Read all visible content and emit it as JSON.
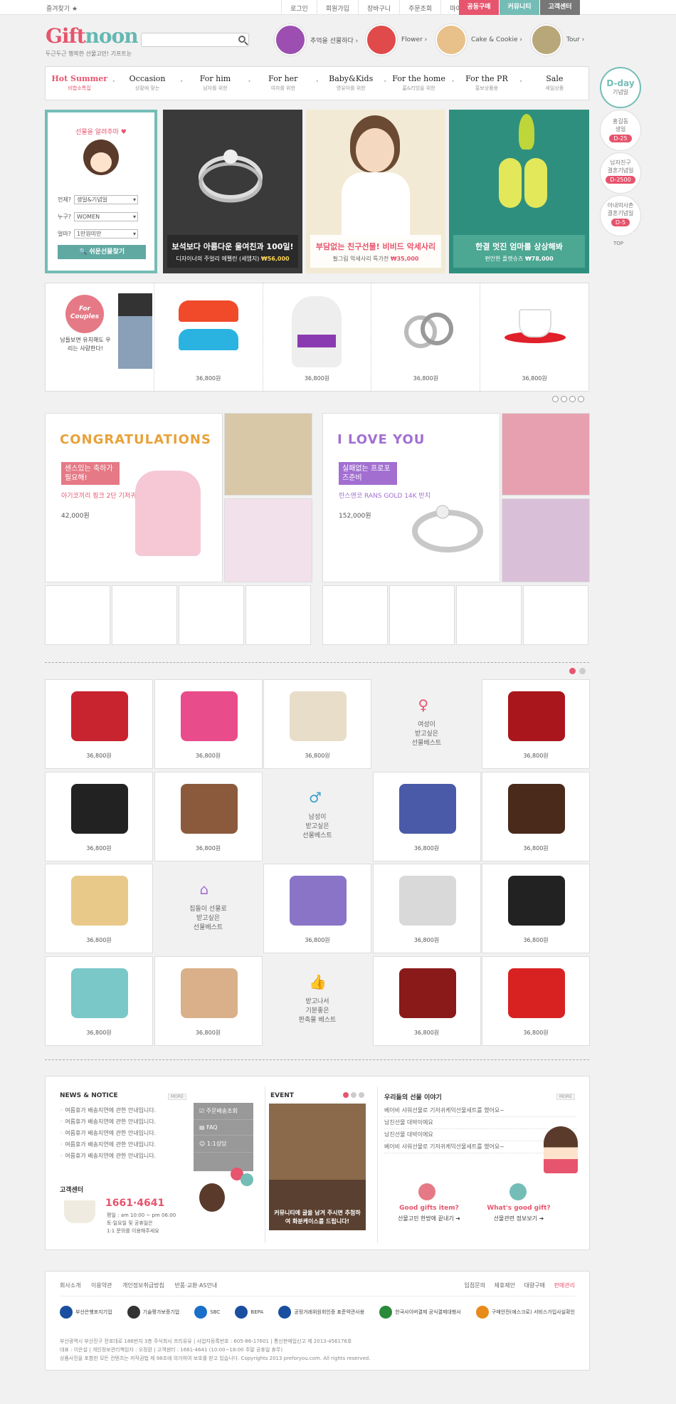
{
  "topbar": {
    "favorite": "즐겨찾기 ★",
    "links": [
      "로그인",
      "회원가입",
      "장바구니",
      "주문조회",
      "마이페이지"
    ],
    "buttons": [
      {
        "label": "공동구매",
        "color": "#e7546d"
      },
      {
        "label": "커뮤니티",
        "color": "#74bdb6"
      },
      {
        "label": "고객센터",
        "color": "#777777"
      }
    ]
  },
  "logo": {
    "part1": "Gift",
    "part2": "noon",
    "tagline": "두근두근 행복한 선물고민! 기프트눈"
  },
  "quick": [
    {
      "label": "추억을 선물하다 ›",
      "color": "#9c4fb0"
    },
    {
      "label": "Flower ›",
      "color": "#e04a4a"
    },
    {
      "label": "Cake & Cookie ›",
      "color": "#e8c08a"
    },
    {
      "label": "Tour ›",
      "color": "#b8a779"
    }
  ],
  "nav": [
    {
      "en": "Hot Summer",
      "ko": "비합소특집"
    },
    {
      "en": "Occasion",
      "ko": "상황에 맞는"
    },
    {
      "en": "For him",
      "ko": "남자를 위한"
    },
    {
      "en": "For her",
      "ko": "여자를 위한"
    },
    {
      "en": "Baby&Kids",
      "ko": "영유아를 위한"
    },
    {
      "en": "For the home",
      "ko": "홈&리빙을 위한"
    },
    {
      "en": "For the PR",
      "ko": "홍보상품용"
    },
    {
      "en": "Sale",
      "ko": "세일상품"
    }
  ],
  "dday": [
    {
      "title": "D-day",
      "sub": "기념일",
      "pill": ""
    },
    {
      "title": "홍길동",
      "sub": "생일",
      "pill": "D-25"
    },
    {
      "title": "남자친구",
      "sub": "결혼기념일",
      "pill": "D-2500"
    },
    {
      "title": "아내의사촌",
      "sub": "결혼기념일",
      "pill": "D-5"
    }
  ],
  "top_label": "TOP",
  "giftform": {
    "title": "선물을 알려주마 ♥",
    "rows": [
      {
        "label": "언제?",
        "value": "생일&기념일"
      },
      {
        "label": "누구?",
        "value": "WOMEN"
      },
      {
        "label": "얼마?",
        "value": "1만원미만"
      }
    ],
    "button": "🔍 쉬운선물찾기"
  },
  "banners": [
    {
      "title": "보석보다 아름다운 울여친과 100일!",
      "sub": "디자이너의 주얼리 에펠런 (세엠지)",
      "price": "₩56,000",
      "bg": "#3a3a3a",
      "cap": "rgba(40,40,40,.85)"
    },
    {
      "title": "부담없는 친구선물! 비비드 악세사리",
      "sub": "필그림 악세사리 특가전",
      "price": "₩35,000",
      "bg": "#f3ead5",
      "cap": "rgba(255,255,255,.85)"
    },
    {
      "title": "한결 멋진 엄마를 상상해봐",
      "sub": "편안한 플랫슈즈",
      "price": "₩78,000",
      "bg": "#2f8f7e",
      "cap": "rgba(50,150,130,.85)"
    }
  ],
  "strip": {
    "promo": "For Couples",
    "promo_text": "남들보면 유치해도 우리는 사랑한다!",
    "prices": [
      "36,800원",
      "36,800원",
      "36,800원",
      "36,800원",
      "36,800원"
    ]
  },
  "promos": [
    {
      "heading": "CONGRATULATIONS",
      "tag": "센스있는 축하가 필요해!",
      "name": "아기코끼리 핑크 2단 기저귀케익",
      "price": "42,000원",
      "color": "#e7546d"
    },
    {
      "heading": "I LOVE YOU",
      "tag": "실패없는 프로포즈준비",
      "name": "란스앤코 RANS GOLD 14K 반지",
      "price": "152,000원",
      "color": "#a26fd1"
    }
  ],
  "grid": [
    {
      "type": "item",
      "price": "36,800원",
      "color": "#c8242f"
    },
    {
      "type": "item",
      "price": "36,800원",
      "color": "#e94c8a"
    },
    {
      "type": "item",
      "price": "36,800원",
      "color": "#e8ddc9"
    },
    {
      "type": "mid",
      "icon": "♀",
      "text": "여성이\n받고싶은\n선물베스트",
      "color": "#e7546d"
    },
    {
      "type": "item",
      "price": "36,800원",
      "color": "#a9171d"
    },
    {
      "type": "item",
      "price": "36,800원",
      "color": "#222222"
    },
    {
      "type": "item",
      "price": "36,800원",
      "color": "#8b5a3c"
    },
    {
      "type": "mid",
      "icon": "♂",
      "text": "남성이\n받고싶은\n선물베스트",
      "color": "#3aa0c8"
    },
    {
      "type": "item",
      "price": "36,800원",
      "color": "#4a5aa8"
    },
    {
      "type": "item",
      "price": "36,800원",
      "color": "#4a2a1a"
    },
    {
      "type": "item",
      "price": "36,800원",
      "color": "#e9c98a"
    },
    {
      "type": "mid",
      "icon": "⌂",
      "text": "집들이 선물로\n받고싶은\n선물베스트",
      "color": "#a26fd1"
    },
    {
      "type": "item",
      "price": "36,800원",
      "color": "#8a74c8"
    },
    {
      "type": "item",
      "price": "36,800원",
      "color": "#d9d9d9"
    },
    {
      "type": "item",
      "price": "36,800원",
      "color": "#222222"
    },
    {
      "type": "item",
      "price": "36,800원",
      "color": "#7ac8c8"
    },
    {
      "type": "item",
      "price": "36,800원",
      "color": "#d9b08a"
    },
    {
      "type": "mid",
      "icon": "👍",
      "text": "받고나서\n기분좋은\n판촉물 베스트",
      "color": "#6ab04c"
    },
    {
      "type": "item",
      "price": "36,800원",
      "color": "#8a1a1a"
    },
    {
      "type": "item",
      "price": "36,800원",
      "color": "#d82222"
    }
  ],
  "notice": {
    "title": "NEWS & NOTICE",
    "more": "MORE",
    "items": [
      "여름휴가 배송지연에 관한 안내입니다.",
      "여름휴가 배송지연에 관한 안내입니다.",
      "여름휴가 배송지연에 관한 안내입니다.",
      "여름휴가 배송지연에 관한 안내입니다.",
      "여름휴가 배송지연에 관한 안내입니다."
    ],
    "quick": [
      "☑ 주문배송조회",
      "▤ FAQ",
      "☺ 1:1상담"
    ]
  },
  "cs": {
    "title": "고객센터",
    "phone": "1661·4641",
    "hours": "평일 : am 10:00 ~ pm 06:00",
    "hours2": "토·일요일 및 공휴일은",
    "hours3": "1:1 문의를 이용해주세요"
  },
  "event": {
    "title": "EVENT",
    "caption": "커뮤니티에 글을 남겨 주시면 추첨하여 화분케이스를 드립니다!"
  },
  "story": {
    "title": "우리들의 선물 이야기",
    "more": "MORE",
    "items": [
      "베이비 샤워선물로 기저귀케익선물세트를 했어요~",
      "남친선물 대박이에요",
      "남친선물 대박이에요",
      "베이비 샤워선물로 기저귀케익선물세트를 했어요~"
    ],
    "links": [
      {
        "title": "Good gifts item?",
        "sub": "선물고민 한방에 끝내기 ➜"
      },
      {
        "title": "What's good gift?",
        "sub": "선물관련 정보보기 ➜"
      }
    ]
  },
  "footer": {
    "links": [
      "회사소개",
      "이용약관",
      "개인정보취급방침",
      "반품·교환·AS안내"
    ],
    "rlinks": [
      "입점문의",
      "제휴제안",
      "대량구매",
      "판매관리"
    ],
    "badges": [
      {
        "t": "부산은행포지기업",
        "c": "#1a4fa0"
      },
      {
        "t": "기술평가보증기업",
        "c": "#333333"
      },
      {
        "t": "SBC",
        "c": "#1a6fc8"
      },
      {
        "t": "BEPA",
        "c": "#1a4fa0"
      },
      {
        "t": "공정거래위원회인증 표준약관사용",
        "c": "#1a4fa0"
      },
      {
        "t": "한국사이버결제 공식결제대행사",
        "c": "#2a8a3a"
      },
      {
        "t": "구매안전(에스크로) 서비스가입사실확인",
        "c": "#e88a1a"
      }
    ],
    "addr1": "부산광역시 부산진구 전포대로 186번지 3층 주식회사 프리유유  |  사업자등록번호 : 605-86-17601  |  통신판매업신고 제 2013-456176호",
    "addr2": "대표 : 이은설  |  개인정보관리책임자 : 오정환  |  고객센터 : 1661-4641 (10:00~18:00  주말 공휴일 휴무)",
    "addr3": "상품사진을 포함한 모든 컨텐츠는 저작권법 제 98조에 의거하여 보호를 받고 있습니다.   Copyrights 2013 preforyou.com. All rights reserved."
  }
}
